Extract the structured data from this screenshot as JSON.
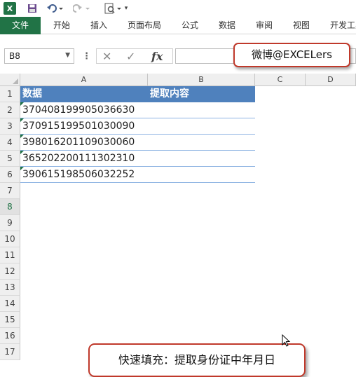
{
  "qat": {
    "app_logo": "X"
  },
  "ribbon": {
    "tabs": [
      "文件",
      "开始",
      "插入",
      "页面布局",
      "公式",
      "数据",
      "审阅",
      "视图",
      "开发工具"
    ]
  },
  "formula_bar": {
    "name_box": "B8",
    "separator": "⋮",
    "cancel": "✕",
    "enter": "✓",
    "fx": "fx",
    "content": ""
  },
  "callouts": {
    "top": "微博@EXCELers",
    "mid": "快速填充：提取身份证中年月日"
  },
  "sheet": {
    "columns": [
      "A",
      "B",
      "C",
      "D"
    ],
    "rows": [
      "1",
      "2",
      "3",
      "4",
      "5",
      "6",
      "7",
      "8",
      "9",
      "10",
      "11",
      "12",
      "13",
      "14",
      "15",
      "16",
      "17"
    ],
    "headers": {
      "a": "数据",
      "b": "提取内容"
    },
    "data": [
      "370408199905036630",
      "370915199501030090",
      "398016201109030060",
      "365202200111302310",
      "390615198506032252"
    ],
    "selected_cell": "B8"
  },
  "colors": {
    "ribbon_accent": "#217346",
    "table_header": "#4f81bd",
    "callout_border": "#c0392b"
  }
}
